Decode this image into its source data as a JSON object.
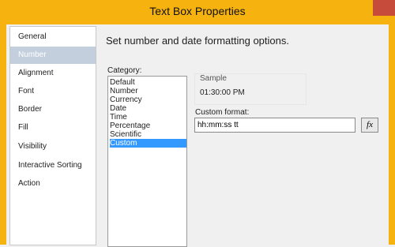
{
  "window": {
    "title": "Text Box Properties"
  },
  "nav": {
    "items": [
      {
        "label": "General"
      },
      {
        "label": "Number"
      },
      {
        "label": "Alignment"
      },
      {
        "label": "Font"
      },
      {
        "label": "Border"
      },
      {
        "label": "Fill"
      },
      {
        "label": "Visibility"
      },
      {
        "label": "Interactive Sorting"
      },
      {
        "label": "Action"
      }
    ],
    "selected": "Number"
  },
  "main": {
    "heading": "Set number and date formatting options.",
    "category_label": "Category:",
    "categories": [
      "Default",
      "Number",
      "Currency",
      "Date",
      "Time",
      "Percentage",
      "Scientific",
      "Custom"
    ],
    "selected_category": "Custom",
    "sample_label": "Sample",
    "sample_value": "01:30:00 PM",
    "custom_format_label": "Custom format:",
    "custom_format_value": "hh:mm:ss tt",
    "fx_label": "fx"
  },
  "colors": {
    "title_bar": "#f6b20e",
    "selected_nav": "#c3cfdd",
    "selected_list": "#3399ff"
  }
}
